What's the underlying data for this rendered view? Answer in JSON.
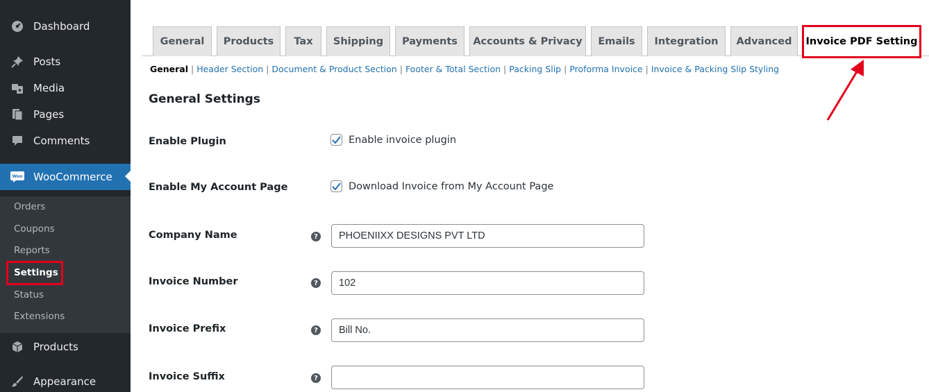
{
  "sidebar": {
    "items": [
      {
        "label": "Dashboard",
        "icon": "dashboard-icon"
      },
      {
        "label": "Posts",
        "icon": "pin-icon"
      },
      {
        "label": "Media",
        "icon": "media-icon"
      },
      {
        "label": "Pages",
        "icon": "pages-icon"
      },
      {
        "label": "Comments",
        "icon": "comment-icon"
      },
      {
        "label": "WooCommerce",
        "icon": "woo-icon"
      },
      {
        "label": "Products",
        "icon": "box-icon"
      },
      {
        "label": "Appearance",
        "icon": "brush-icon"
      }
    ],
    "woo_logo_text": "Woo",
    "submenu": [
      "Orders",
      "Coupons",
      "Reports",
      "Settings",
      "Status",
      "Extensions"
    ],
    "active_color": "#2271b1",
    "highlight_color": "#e3001b"
  },
  "tabs": [
    "General",
    "Products",
    "Tax",
    "Shipping",
    "Payments",
    "Accounts & Privacy",
    "Emails",
    "Integration",
    "Advanced",
    "Invoice PDF Setting"
  ],
  "subnav": {
    "current": "General",
    "links": [
      "Header Section",
      "Document & Product Section",
      "Footer & Total Section",
      "Packing Slip",
      "Proforma Invoice",
      "Invoice & Packing Slip Styling"
    ],
    "separator": "|"
  },
  "section_title": "General Settings",
  "fields": {
    "enable_plugin": {
      "label": "Enable Plugin",
      "checkbox_label": "Enable invoice plugin",
      "checked": true
    },
    "enable_account": {
      "label": "Enable My Account Page",
      "checkbox_label": "Download Invoice from My Account Page",
      "checked": true
    },
    "company_name": {
      "label": "Company Name",
      "value": "PHOENIIXX DESIGNS PVT LTD"
    },
    "invoice_number": {
      "label": "Invoice Number",
      "value": "102"
    },
    "invoice_prefix": {
      "label": "Invoice Prefix",
      "value": "Bill No."
    },
    "invoice_suffix": {
      "label": "Invoice Suffix",
      "value": ""
    },
    "help_glyph": "?"
  }
}
